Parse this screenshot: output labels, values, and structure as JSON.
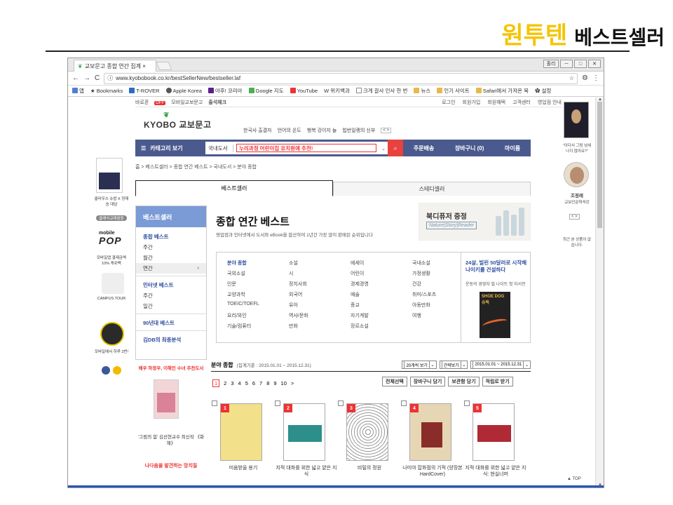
{
  "slide": {
    "title_hl": "원투텐",
    "title_rest": "베스트셀러"
  },
  "browser": {
    "tab_title": "교보문고 종합 연간 집계 ×",
    "win_user": "홀리",
    "win_min": "－",
    "win_max": "□",
    "win_close": "✕",
    "url": "www.kyobobook.co.kr/bestSellerNew/bestseller.laf",
    "bookmarks": [
      "앱",
      "Bookmarks",
      "T-ROVER",
      "Apple Korea",
      "야후! 코리아",
      "Google 지도",
      "YouTube",
      "위키백과",
      "크게 갈사 인사 한 번",
      "뉴스",
      "인기 사이트",
      "Safari에서 가져온 북",
      "설정"
    ]
  },
  "util": {
    "left": [
      "바로폰",
      "OFF",
      "모바일교보문고",
      "출석체크"
    ],
    "right": [
      "로그인",
      "회원가입",
      "회원혜택",
      "고객센터",
      "영업점 안내"
    ]
  },
  "logo": "KYOBO 교보문고",
  "gnb": [
    "한국사 출결자",
    "언어의 온도",
    "행복 강이지 놀",
    "힙반일랭의 신부"
  ],
  "nav": {
    "category": "카테고리 보기",
    "search_scope": "국내도서",
    "search_value": "누리과정 어린이집 유치원에 추천!",
    "links": [
      "주문배송",
      "장바구니 (0)",
      "마이룸"
    ]
  },
  "breadcrumb": "홈 > 베스트셀러 > 종합 연간 베스트 > 국내도서 > 분야 종합",
  "tabs": [
    "베스트셀러",
    "스테디셀러"
  ],
  "lnb": {
    "header": "베스트셀러",
    "groups": [
      {
        "title": "종합 베스트",
        "items": [
          "주간",
          "월간",
          "연간"
        ]
      },
      {
        "title": "인터넷 베스트",
        "items": [
          "주간",
          "일간"
        ]
      },
      {
        "title": "90년대 베스트",
        "items": []
      },
      {
        "title": "김DB의 최종분석",
        "items": []
      }
    ]
  },
  "main": {
    "title": "종합 연간 베스트",
    "desc": "영업점과 인터넷에서 도서와 eBook을 합산하여 1년간 가장 많이 판매된 순위입니다"
  },
  "banner": {
    "title": "북디퓨저 증정",
    "sub": "Nature|Story|Reader"
  },
  "categories": [
    "분야 종합",
    "소설",
    "에세이",
    "국내소설",
    "국외소설",
    "시",
    "어린이",
    "가정생활",
    "인문",
    "정치사회",
    "경제경영",
    "건강",
    "교양과학",
    "외국어",
    "예술",
    "취미/스포츠",
    "TOEIC/TOEFL",
    "유아",
    "종교",
    "아동만화",
    "요리/와인",
    "역사/문화",
    "자기계발",
    "여행",
    "기술/컴퓨터",
    "만화",
    "장르소설"
  ],
  "catpromo": {
    "title": "24살, 빌린 50달러로 시작해 나이키를 건설하다",
    "sub": "운동의 경영자 필 나이트 첫 자서전",
    "book": "SHOE DOG 슈독"
  },
  "listhead": {
    "title": "분야 종합",
    "period": "(집계기준 : 2015.01.01 ~ 2015.12.31)",
    "view": "20개씩 보기",
    "view2": "간략보기",
    "range": "2015.01.01 ~ 2015.12.31"
  },
  "pager": [
    "1",
    "2",
    "3",
    "4",
    "5",
    "6",
    "7",
    "8",
    "9",
    "10",
    ">"
  ],
  "actions": [
    "전체선택",
    "장바구니 담기",
    "보관함 담기",
    "적립로 받기"
  ],
  "books": [
    {
      "rank": "1",
      "title": "미움받을 용기"
    },
    {
      "rank": "2",
      "title": "지적 대화를 위한 넓고 얕은 지식"
    },
    {
      "rank": "3",
      "title": "비밀의 정원"
    },
    {
      "rank": "4",
      "title": "나미야 잡화점의 기적 (양장본 HardCover)"
    },
    {
      "rank": "5",
      "title": "지적 대화를 위한 넓고 얕은 지식: 현실너머"
    }
  ],
  "lside": {
    "promo1": "클라우스 슈밥 X 정재승 대담",
    "badge1": "클래식교재음원",
    "mobile1": "mobile",
    "mobile2": "POP",
    "mobile_cap": "모바일앱 결제금액 10% 캐쉬백",
    "campus": "CAMPUS TOUR",
    "badge_cap": "모바일에서 하루 3번!"
  },
  "lpromo": {
    "head": "배우 하정우, 이해인 수녀 추천도서",
    "cap": "'그림의 힘' 김선현교수 최신작 《화해》",
    "head2": "나다움을 발견하는 망치질"
  },
  "rside": {
    "cap1": "\"이다서 그림 넘세나지 않아요?\"",
    "name": "조정래",
    "role": "교보인문학석강",
    "pg": "< >",
    "empty": "최근 본 상품이 없습니다.",
    "top": "▲ TOP"
  }
}
